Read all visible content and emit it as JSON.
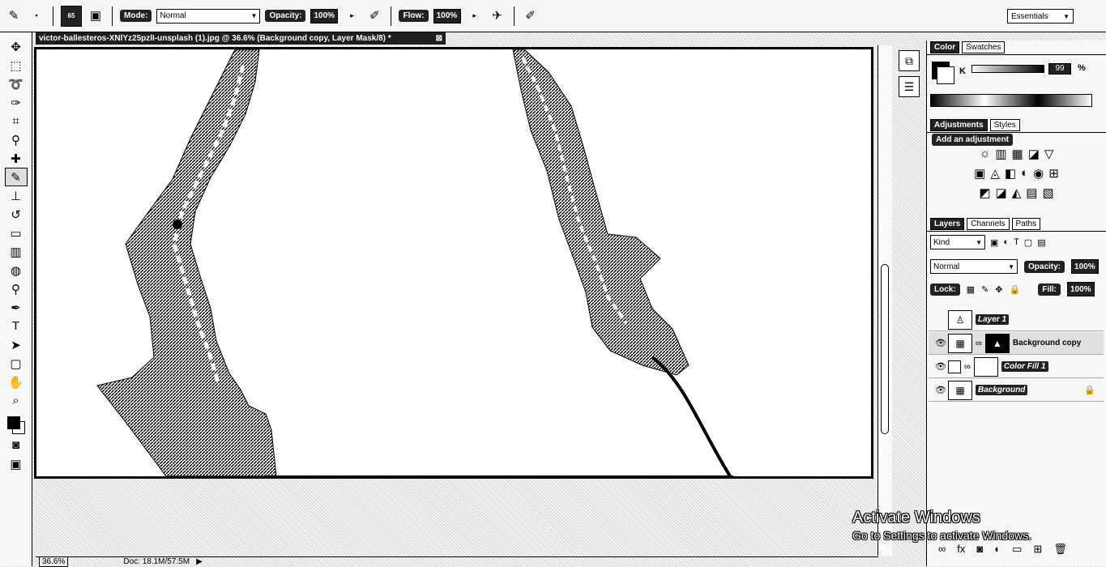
{
  "options_bar": {
    "brush_size": "65",
    "mode_label": "Mode:",
    "mode_value": "Normal",
    "opacity_label": "Opacity:",
    "opacity_value": "100%",
    "flow_label": "Flow:",
    "flow_value": "100%",
    "workspace": "Essentials"
  },
  "document": {
    "tab_title": "victor-ballesteros-XNlYz25pzlI-unsplash (1).jpg @ 36.6% (Background copy, Layer Mask/8) *",
    "close_glyph": "⊠"
  },
  "statusbar": {
    "zoom": "36.6%",
    "doc_info": "Doc: 18.1M/57.5M"
  },
  "panels": {
    "color_tabs": [
      "Color",
      "Swatches"
    ],
    "channel_label": "K",
    "channel_value": "99",
    "channel_unit": "%",
    "adjust_tabs": [
      "Adjustments",
      "Styles"
    ],
    "add_adjustment": "Add an adjustment",
    "layer_tabs": [
      "Layers",
      "Channels",
      "Paths"
    ],
    "kind_value": "Kind",
    "blend_mode": "Normal",
    "opacity_label": "Opacity:",
    "opacity_value": "100%",
    "lock_label": "Lock:",
    "fill_label": "Fill:",
    "fill_value": "100%",
    "layers": [
      {
        "name": "Layer 1"
      },
      {
        "name": "Background copy"
      },
      {
        "name": "Color Fill 1"
      },
      {
        "name": "Background"
      }
    ]
  },
  "watermark": {
    "line1": "Activate Windows",
    "line2": "Go to Settings to activate Windows."
  }
}
